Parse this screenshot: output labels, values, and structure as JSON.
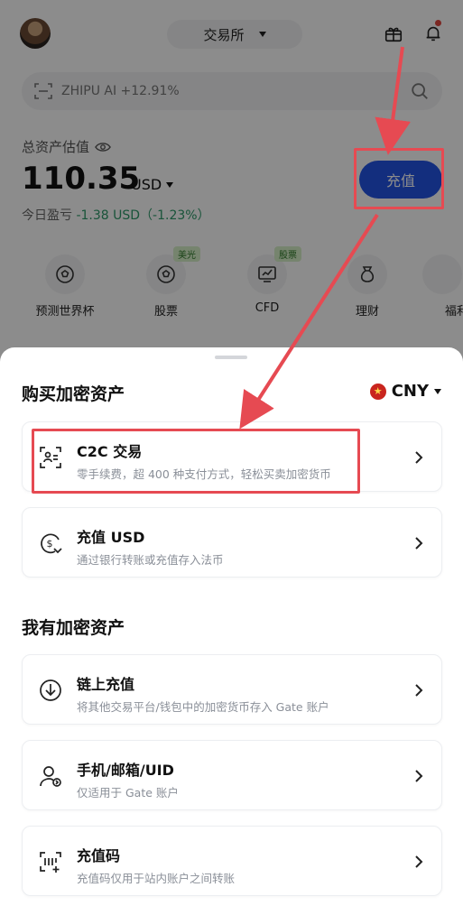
{
  "header": {
    "exchange_label": "交易所"
  },
  "search": {
    "placeholder": "ZHIPU AI +12.91%"
  },
  "assets": {
    "label": "总资产估值",
    "value": "110.35",
    "unit": "USD",
    "pnl_label": "今日盈亏",
    "pnl_value": "-1.38 USD（-1.23%）"
  },
  "deposit_button": "充值",
  "quick_actions": [
    {
      "label": "预测世界杯",
      "badge": "",
      "icon": "soccer-ball-icon"
    },
    {
      "label": "股票",
      "badge": "美光",
      "icon": "soccer-ball-icon"
    },
    {
      "label": "CFD",
      "badge": "股票",
      "icon": "chart-screen-icon"
    },
    {
      "label": "理财",
      "badge": "",
      "icon": "wallet-bag-icon"
    },
    {
      "label": "福利",
      "badge": "",
      "icon": "gift-icon"
    }
  ],
  "sheet": {
    "buy_title": "购买加密资产",
    "currency": "CNY",
    "own_title": "我有加密资产",
    "buy_options": [
      {
        "title": "C2C 交易",
        "desc": "零手续费，超 400 种支付方式，轻松买卖加密货币",
        "icon": "c2c-trade-icon"
      },
      {
        "title": "充值 USD",
        "desc": "通过银行转账或充值存入法币",
        "icon": "dollar-deposit-icon"
      }
    ],
    "own_options": [
      {
        "title": "链上充值",
        "desc": "将其他交易平台/钱包中的加密货币存入 Gate 账户",
        "icon": "download-icon"
      },
      {
        "title": "手机/邮箱/UID",
        "desc": "仅适用于 Gate 账户",
        "icon": "user-transfer-icon"
      },
      {
        "title": "充值码",
        "desc": "充值码仅用于站内账户之间转账",
        "icon": "code-scan-icon"
      }
    ]
  },
  "colors": {
    "primary": "#2354e6",
    "annotation_red": "#e64a52",
    "positive_green": "#2e9a6a"
  }
}
